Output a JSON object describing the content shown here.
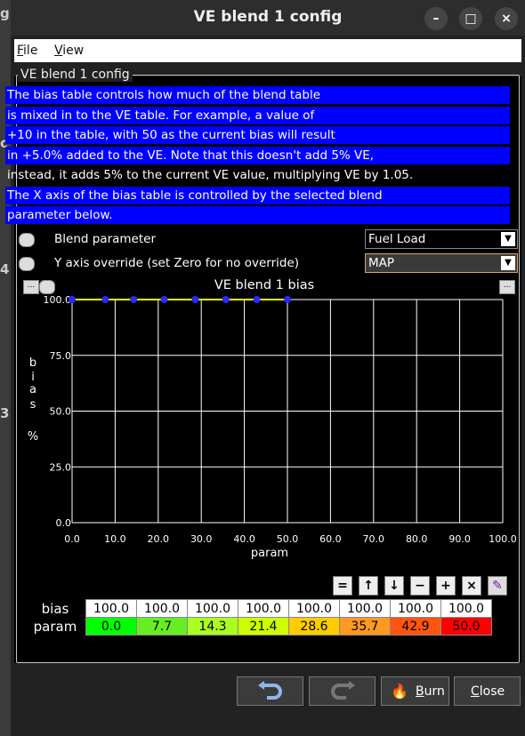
{
  "window": {
    "title": "VE blend 1 config",
    "controls": {
      "minimize": "–",
      "maximize": "□",
      "close": "×"
    }
  },
  "menu": [
    {
      "label": "File",
      "key": "F",
      "rest": "ile"
    },
    {
      "label": "View",
      "key": "V",
      "rest": "iew"
    }
  ],
  "group_title": "VE blend 1 config",
  "description": [
    {
      "text": "The bias table controls how much of the blend table",
      "highlight": true
    },
    {
      "text": "is mixed in to the VE table. For example, a value of",
      "highlight": true
    },
    {
      "text": "+10 in the table, with 50 as the current bias will result",
      "highlight": true
    },
    {
      "text": "in +5.0% added to the VE. Note that this doesn't add 5% VE,",
      "highlight": true
    },
    {
      "text": "instead, it adds 5% to the current VE value, multiplying VE by 1.05.",
      "highlight": false
    },
    {
      "text": "The X axis of the bias table is controlled by the selected blend",
      "highlight": true
    },
    {
      "text": "parameter below.",
      "highlight": true
    }
  ],
  "params": [
    {
      "label": "Blend parameter",
      "value": "Fuel Load",
      "icon": "help-icon"
    },
    {
      "label": "Y axis override (set Zero for no override)",
      "value": "MAP",
      "icon": "help-icon"
    }
  ],
  "chart_header": {
    "menu_button": "...",
    "title": "VE blend 1 bias",
    "options_button": "..."
  },
  "chart_data": {
    "type": "line",
    "title": "VE blend 1 bias",
    "xlabel": "param",
    "ylabel": "bias %",
    "ylabel_letters": [
      "b",
      "i",
      "a",
      "s",
      "%"
    ],
    "x": [
      0.0,
      7.7,
      14.3,
      21.4,
      28.6,
      35.7,
      42.9,
      50.0
    ],
    "series": [
      {
        "values": [
          100.0,
          100.0,
          100.0,
          100.0,
          100.0,
          100.0,
          100.0,
          100.0
        ]
      }
    ],
    "xlim": [
      0,
      100
    ],
    "ylim": [
      0,
      100
    ],
    "xticks": [
      "0.0",
      "10.0",
      "20.0",
      "30.0",
      "40.0",
      "50.0",
      "60.0",
      "70.0",
      "80.0",
      "90.0",
      "100.0"
    ],
    "yticks": [
      "0.0",
      "25.0",
      "50.0",
      "75.0",
      "100.0"
    ],
    "grid": true,
    "colors": {
      "line": "#ffff00",
      "points": "#2a2aff",
      "grid": "#ffffff",
      "background": "#000000"
    }
  },
  "table": {
    "row_labels": {
      "bias": "bias",
      "param": "param"
    },
    "bias": [
      "100.0",
      "100.0",
      "100.0",
      "100.0",
      "100.0",
      "100.0",
      "100.0",
      "100.0"
    ],
    "param": [
      "0.0",
      "7.7",
      "14.3",
      "21.4",
      "28.6",
      "35.7",
      "42.9",
      "50.0"
    ],
    "param_colors": [
      "#00ff00",
      "#66ee22",
      "#aaff22",
      "#ccff00",
      "#ffcc00",
      "#ff9922",
      "#ff5511",
      "#ff0000"
    ]
  },
  "toolbar": [
    {
      "name": "equal-button",
      "glyph": "="
    },
    {
      "name": "increase-button",
      "glyph": "↑"
    },
    {
      "name": "decrease-button",
      "glyph": "↓"
    },
    {
      "name": "subtract-button",
      "glyph": "−"
    },
    {
      "name": "add-button",
      "glyph": "+"
    },
    {
      "name": "multiply-button",
      "glyph": "×"
    },
    {
      "name": "draw-button",
      "glyph": "✎"
    }
  ],
  "footer": {
    "burn": {
      "key": "B",
      "rest": "urn",
      "label": "Burn"
    },
    "close": {
      "key": "C",
      "rest": "lose",
      "label": "Close"
    }
  }
}
